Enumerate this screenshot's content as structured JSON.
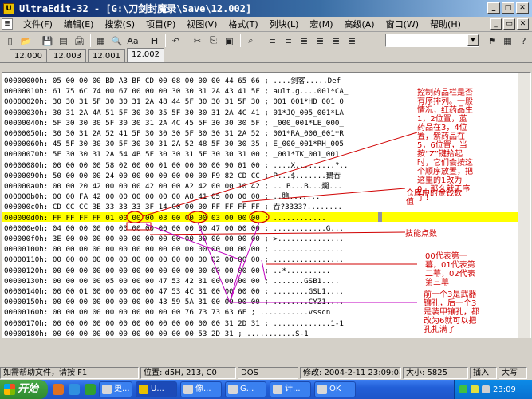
{
  "window": {
    "title": "UltraEdit-32 - [G:\\刀剑封魔录\\Save\\12.002]",
    "app_icon_glyph": "U",
    "title_icon": "ultraedit-logo-icon"
  },
  "menu": [
    "文件(F)",
    "编辑(E)",
    "搜索(S)",
    "项目(P)",
    "视图(V)",
    "格式(T)",
    "列块(L)",
    "宏(M)",
    "高级(A)",
    "窗口(W)",
    "帮助(H)"
  ],
  "toolbar": {
    "icons": [
      "new-file-icon",
      "open-file-icon",
      "save-icon",
      "save-all-icon",
      "print-icon",
      "print-preview-icon",
      "find-icon",
      "font-icon",
      "hex-mode-icon",
      "undo-icon",
      "cut-icon",
      "copy-icon",
      "paste-icon",
      "find-replace-icon",
      "indent-icon",
      "outdent-icon",
      "align-left-icon",
      "align-center-icon",
      "align-right-icon",
      "justify-icon"
    ],
    "glyphs": [
      "▯",
      "📂",
      "💾",
      "▤",
      "🖨",
      "▦",
      "🔍",
      "Aa",
      "H",
      "↶",
      "✂",
      "⎘",
      "▣",
      "⌕",
      "≡",
      "≡",
      "≣",
      "≣",
      "≣",
      "≣"
    ],
    "hex_label": "H",
    "combo_value": ""
  },
  "tabs": [
    "12.000",
    "12.003",
    "12.001",
    "12.002"
  ],
  "active_tab": 3,
  "hex_rows": [
    "00000000h: 05 00 00 00 BD A3 BF CD 00 08 00 00 00 44 65 66 ; ....剑客.....Def",
    "00000010h: 61 75 6C 74 00 67 00 00 00 30 30 31 2A 43 41 5F ; ault.g....001*CA_",
    "00000020h: 30 30 31 5F 30 30 31 2A 48 44 5F 30 30 31 5F 30 ; 001_001*HD_001_0",
    "00000030h: 30 31 2A 4A 51 5F 30 30 35 5F 30 30 31 2A 4C 41 ; 01*JQ_005_001*LA",
    "00000040h: 5F 30 30 30 5F 30 30 31 2A 4C 45 5F 30 30 30 5F ; _000_001*LE_000_",
    "00000050h: 30 30 31 2A 52 41 5F 30 30 30 5F 30 30 31 2A 52 ; 001*RA_000_001*R",
    "00000060h: 45 5F 30 30 30 5F 30 30 31 2A 52 48 5F 30 30 35 ; E_000_001*RH_005",
    "00000070h: 5F 30 30 31 2A 54 4B 5F 30 30 31 5F 30 30 31 00 ; _001*TK_001_001.",
    "00000080h: 00 00 00 00 58 02 00 00 01 00 00 00 00 90 01 00 ; ....X.........?..",
    "00000090h: 50 00 00 00 24 00 00 00 00 00 00 00 F9 82 CD CC ; P...$.......鵝吞",
    "000000a0h: 00 00 20 42 00 00 00 42 00 00 A2 42 00 00 10 42 ; .. B...B...燗...",
    "000000b0h: 00 00 FA 42 00 00 00 00 00 00 A8 41 05 00 00 00 ; ..鵙.......",
    "000000c0h: CD CC CC 3E 33 33 33 3F 14 00 00 00 FF FF FF FF ; 吞?3333?........",
    "000000d0h: FF FF FF FF 01 00 00 00 03 00 00 00 03 00 00 00 ; ............",
    "000000e0h: 04 00 00 00 00 00 00 00 00 00 00 00 47 00 00 00 ; ............G...",
    "000000f0h: 3E 00 00 00 00 00 00 00 00 00 00 00 00 00 00 00 ; >...............",
    "00000100h: 00 00 00 00 00 00 00 00 00 00 00 00 00 00 00 00 ; ................",
    "00000110h: 00 00 00 00 00 00 00 00 00 00 00 00 02 00 00 00 ; ................",
    "00000120h: 00 00 00 00 00 00 00 00 00 00 00 00 00 00 00 00 ; ..*..........",
    "00000130h: 00 00 00 00 05 00 00 00 47 53 42 31 00 00 00 00 ; .......GSB1....",
    "00000140h: 00 00 01 00 00 00 00 00 47 53 4C 31 00 00 00 00 ; ........GSL1....",
    "00000150h: 00 00 00 00 00 00 00 00 43 59 5A 31 00 00 00 00 ; ........CYZ1....",
    "00000160h: 00 00 00 00 00 00 00 00 00 00 76 73 73 63 6E ; ...........vsscn",
    "00000170h: 00 00 00 00 00 00 00 00 00 00 00 00 00 31 2D 31 ; .............1-1",
    "00000180h: 00 00 00 00 00 00 00 00 00 00 00 53 2D 31 ; ...........S-1"
  ],
  "annotations": {
    "sort": "控制药品栏是否有序排列。一般情况，红药品生1，2位置，蓝药品在3，4位置，紫药品在5，6位置，当按“Z”键拾起时，它们会按这个顺序放置，把这里的1改为0，那么就无序了！",
    "money": "仓库中的金钱数值",
    "skill": "技能点数",
    "act": "00代表第一幕，01代表第二幕，02代表第三幕",
    "weapon": "前一个3是武器镶孔，后一个3是装甲镶孔，都改为6就可以把孔扎满了"
  },
  "status": {
    "help": "如需帮助文件，请按 F1",
    "position": "位置: d5H, 213, C0",
    "format": "DOS",
    "modified": "修改: 2004-2-11 23:09:04",
    "size": "大小: 5825",
    "insert": "插入",
    "mode": "大写"
  },
  "taskbar": {
    "start": "开始",
    "tasks": [
      "更...",
      "U...",
      "像...",
      "G...",
      "计...",
      "OK"
    ],
    "clock": "23:09"
  }
}
